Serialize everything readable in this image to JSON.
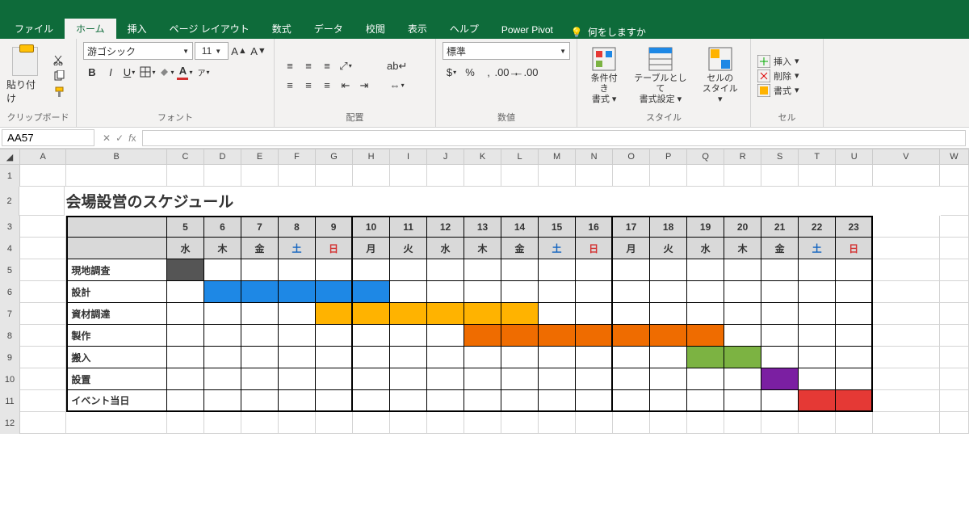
{
  "tabs": [
    "ファイル",
    "ホーム",
    "挿入",
    "ページ レイアウト",
    "数式",
    "データ",
    "校閲",
    "表示",
    "ヘルプ",
    "Power Pivot"
  ],
  "active_tab": "ホーム",
  "tell_me": "何をしますか",
  "ribbon": {
    "clipboard": {
      "paste": "貼り付け",
      "label": "クリップボード"
    },
    "font": {
      "name": "游ゴシック",
      "size": "11",
      "label": "フォント",
      "underline_color": "#d32f2f",
      "fill_color": "#ffeb3b"
    },
    "align": {
      "label": "配置"
    },
    "number": {
      "format": "標準",
      "label": "数値"
    },
    "styles": {
      "cond": "条件付き\n書式 ▾",
      "tbl": "テーブルとして\n書式設定 ▾",
      "cell": "セルの\nスタイル ▾",
      "label": "スタイル"
    },
    "cells": {
      "ins": "挿入",
      "del": "削除",
      "fmt": "書式",
      "label": "セル"
    }
  },
  "namebox": "AA57",
  "sheet_title": "会場設営のスケジュール",
  "col_letters": [
    "A",
    "B",
    "C",
    "D",
    "E",
    "F",
    "G",
    "H",
    "I",
    "J",
    "K",
    "L",
    "M",
    "N",
    "O",
    "P",
    "Q",
    "R",
    "S",
    "T",
    "U",
    "V",
    "W"
  ],
  "row_numbers": [
    "1",
    "2",
    "3",
    "4",
    "5",
    "6",
    "7",
    "8",
    "9",
    "10",
    "11",
    "12"
  ],
  "dates": [
    "5",
    "6",
    "7",
    "8",
    "9",
    "10",
    "11",
    "12",
    "13",
    "14",
    "15",
    "16",
    "17",
    "18",
    "19",
    "20",
    "21",
    "22",
    "23"
  ],
  "weekdays": [
    "水",
    "木",
    "金",
    "土",
    "日",
    "月",
    "火",
    "水",
    "木",
    "金",
    "土",
    "日",
    "月",
    "火",
    "水",
    "木",
    "金",
    "土",
    "日"
  ],
  "weekday_class": [
    "",
    "",
    "",
    "sat",
    "sun",
    "",
    "",
    "",
    "",
    "",
    "sat",
    "sun",
    "",
    "",
    "",
    "",
    "",
    "sat",
    "sun"
  ],
  "tasks": [
    {
      "name": "現地調査",
      "fill": "fill-dark",
      "cols": [
        0
      ]
    },
    {
      "name": "設計",
      "fill": "fill-blue",
      "cols": [
        1,
        2,
        3,
        4,
        5
      ]
    },
    {
      "name": "資材調達",
      "fill": "fill-ylw",
      "cols": [
        4,
        5,
        6,
        7,
        8,
        9
      ]
    },
    {
      "name": "製作",
      "fill": "fill-orn",
      "cols": [
        8,
        9,
        10,
        11,
        12,
        13,
        14
      ]
    },
    {
      "name": "搬入",
      "fill": "fill-grn",
      "cols": [
        14,
        15
      ]
    },
    {
      "name": "設置",
      "fill": "fill-pur",
      "cols": [
        16
      ]
    },
    {
      "name": "イベント当日",
      "fill": "fill-red",
      "cols": [
        17,
        18
      ]
    }
  ],
  "thick_after": [
    4,
    11,
    18
  ]
}
